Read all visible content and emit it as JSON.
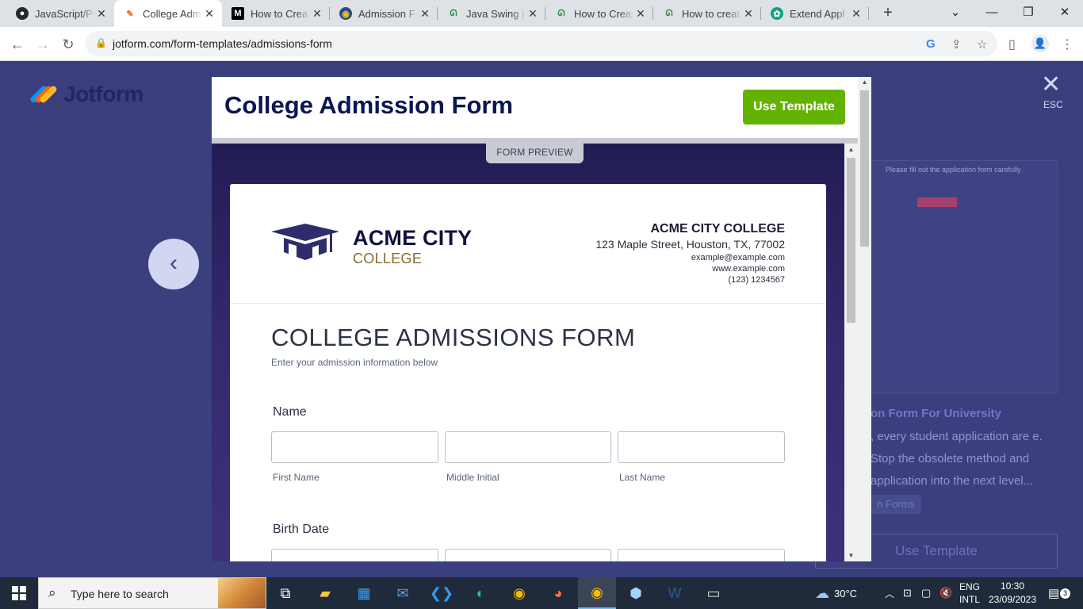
{
  "browser": {
    "tabs": [
      {
        "title": "JavaScript/Pr",
        "icon": "github-icon",
        "active": false
      },
      {
        "title": "College Adm",
        "icon": "jotform-icon",
        "active": true
      },
      {
        "title": "How to Crea",
        "icon": "medium-icon",
        "active": false
      },
      {
        "title": "Admission F",
        "icon": "site-icon",
        "active": false
      },
      {
        "title": "Java Swing |",
        "icon": "geeksforgeeks-icon",
        "active": false
      },
      {
        "title": "How to Crea",
        "icon": "geeksforgeeks-icon",
        "active": false
      },
      {
        "title": "How to creat",
        "icon": "geeksforgeeks-icon",
        "active": false
      },
      {
        "title": "Extend Appl",
        "icon": "chatgpt-icon",
        "active": false
      }
    ],
    "url": "jotform.com/form-templates/admissions-form"
  },
  "page": {
    "brand": "Jotform",
    "esc_label": "ESC",
    "bg_card_text": "Please fill out the application form carefully",
    "bg_title": "on Form For University",
    "bg_desc": ", every student application are e. Stop the obsolete method and application into the next level...",
    "bg_chip": "n Forms",
    "bg_button": "Use Template"
  },
  "modal": {
    "title": "College Admission Form",
    "use_template": "Use Template",
    "preview_label": "FORM PREVIEW"
  },
  "form": {
    "college_logo_line1": "ACME CITY",
    "college_logo_line2": "COLLEGE",
    "address": {
      "name": "ACME CITY COLLEGE",
      "street": "123 Maple Street, Houston, TX, 77002",
      "email": "example@example.com",
      "web": "www.example.com",
      "phone": "(123) 1234567"
    },
    "title": "COLLEGE ADMISSIONS FORM",
    "subtitle": "Enter your admission information below",
    "name_label": "Name",
    "first_name": "First Name",
    "middle_initial": "Middle Initial",
    "last_name": "Last Name",
    "birth_date_label": "Birth Date"
  },
  "taskbar": {
    "search_placeholder": "Type here to search",
    "weather": "30°C",
    "lang_line1": "ENG",
    "lang_line2": "INTL",
    "time": "10:30",
    "date": "23/09/2023",
    "notifications": "3"
  },
  "colors": {
    "jotform_navy": "#0a1551",
    "use_template_green": "#64b200",
    "backdrop": "#3b3f7e"
  }
}
